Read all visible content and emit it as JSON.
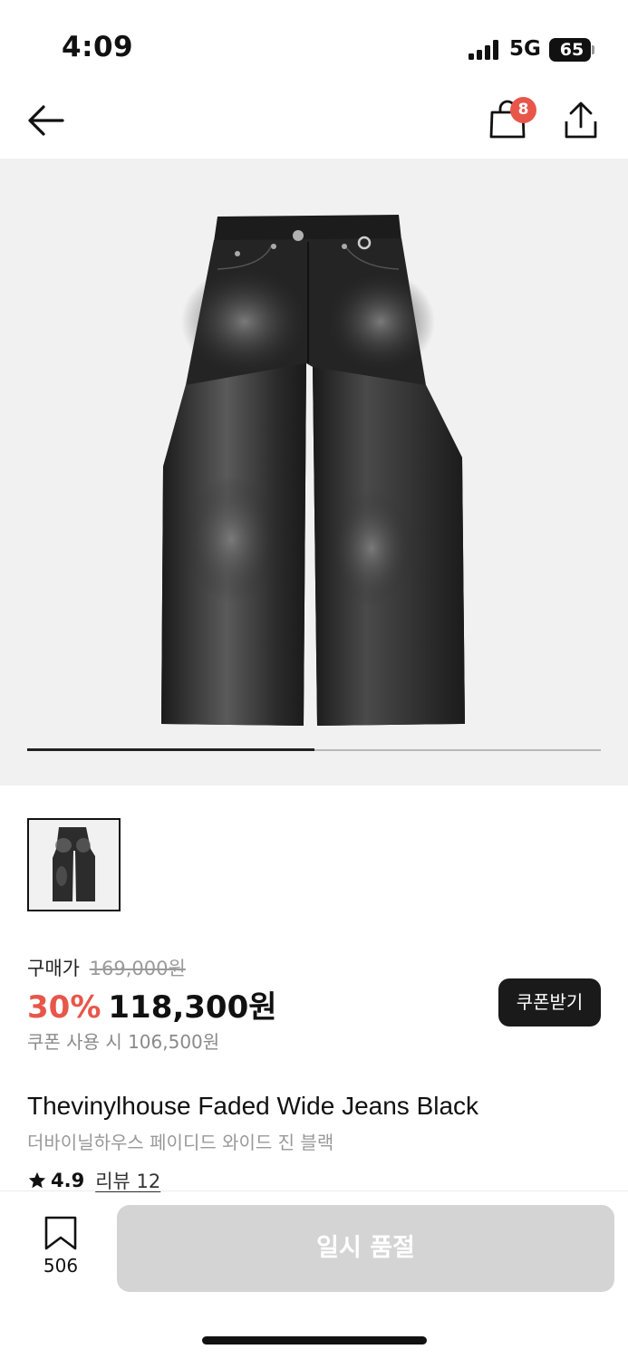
{
  "status_bar": {
    "time": "4:09",
    "network": "5G",
    "battery": "65"
  },
  "nav": {
    "cart_count": "8",
    "icons": [
      "back-arrow-icon",
      "shopping-bag-icon",
      "share-icon"
    ]
  },
  "gallery": {
    "current_image_progress": 0.5,
    "thumbnail_count": 1
  },
  "price": {
    "label": "구매가",
    "original": "169,000원",
    "discount": "30%",
    "sale": "118,300원",
    "coupon_text": "쿠폰 사용 시 106,500원",
    "coupon_button": "쿠폰받기"
  },
  "product": {
    "title_en": "Thevinylhouse Faded Wide Jeans Black",
    "title_ko": "더바이닐하우스 페이디드 와이드 진 블랙",
    "rating": "4.9",
    "review_label": "리뷰 12"
  },
  "bottom_bar": {
    "bookmark_count": "506",
    "soldout_label": "일시 품절"
  },
  "colors": {
    "accent": "#e8564a",
    "button_dark": "#1a1a1a",
    "disabled": "#d4d4d4"
  }
}
